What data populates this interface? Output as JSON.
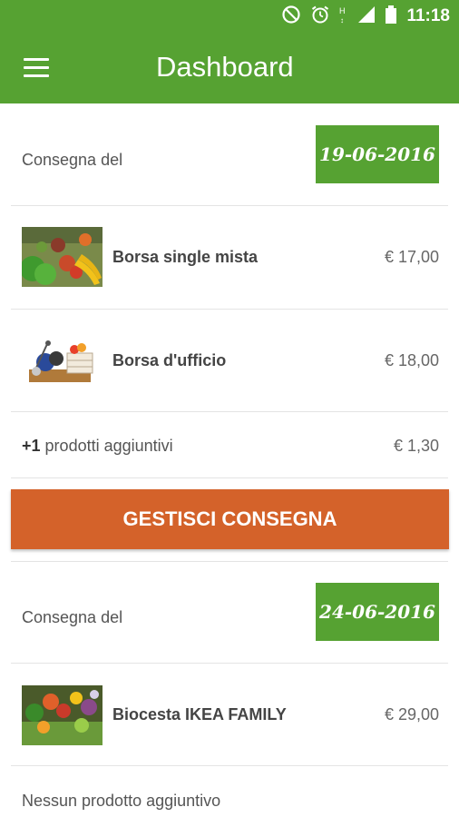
{
  "status_bar": {
    "time": "11:18",
    "icons": [
      "block-icon",
      "alarm-icon",
      "signal-h-icon",
      "signal-icon",
      "battery-icon"
    ]
  },
  "app_bar": {
    "title": "Dashboard",
    "menu_icon": "hamburger-icon"
  },
  "deliveries": [
    {
      "label": "Consegna del",
      "date": "19-06-2016",
      "products": [
        {
          "name": "Borsa single mista",
          "price": "€ 17,00",
          "image": "vegetable-basket-image"
        },
        {
          "name": "Borsa d'ufficio",
          "price": "€ 18,00",
          "image": "office-basket-image"
        }
      ],
      "addon": {
        "count": "+1",
        "text": "prodotti aggiuntivi",
        "price": "€ 1,30"
      },
      "button": "GESTISCI CONSEGNA"
    },
    {
      "label": "Consegna del",
      "date": "24-06-2016",
      "products": [
        {
          "name": "Biocesta IKEA FAMILY",
          "price": "€ 29,00",
          "image": "biocesta-image"
        }
      ],
      "addon": {
        "text": "Nessun prodotto aggiuntivo"
      }
    }
  ],
  "colors": {
    "primary": "#56a232",
    "accent": "#d4622a"
  }
}
